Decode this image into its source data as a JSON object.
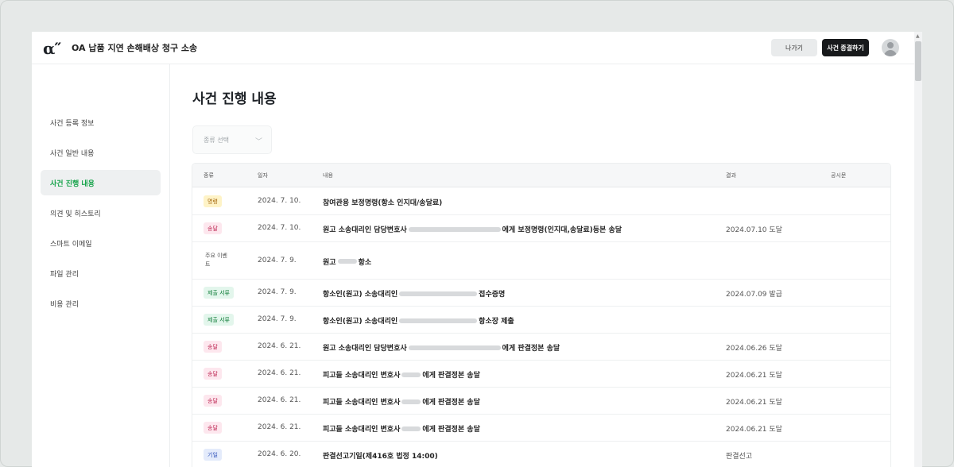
{
  "header": {
    "logo": "α″",
    "case_title": "OA 납품 지연 손해배상 청구 소송",
    "exit_label": "나가기",
    "close_case_label": "사건 종결하기",
    "avatar_icon": "user-avatar-icon"
  },
  "sidebar": {
    "items": [
      {
        "label": "사건 등록 정보",
        "active": false
      },
      {
        "label": "사건 일반 내용",
        "active": false
      },
      {
        "label": "사건 진행 내용",
        "active": true
      },
      {
        "label": "의견 및 히스토리",
        "active": false
      },
      {
        "label": "스마트 이메일",
        "active": false
      },
      {
        "label": "파일 관리",
        "active": false
      },
      {
        "label": "비용 관리",
        "active": false
      }
    ]
  },
  "main": {
    "title": "사건 진행 내용",
    "type_select_placeholder": "종류 선택",
    "table": {
      "columns": [
        "종류",
        "일자",
        "내용",
        "결과",
        "공시문"
      ],
      "rows": [
        {
          "type": "명령",
          "type_style": "t-order",
          "date": "2024. 7. 10.",
          "content_pre": "참여관용 보정명령(항소 인지대/송달료)",
          "redact_width": 0,
          "content_post": "",
          "result": ""
        },
        {
          "type": "송달",
          "type_style": "t-deliver",
          "date": "2024. 7. 10.",
          "content_pre": "원고 소송대리인 담당변호사",
          "redact_width": 116,
          "content_post": "에게 보정명령(인지대,송달료)등본 송달",
          "result": "2024.07.10 도달"
        },
        {
          "type": "주요 이벤트",
          "type_style": "t-event",
          "date": "2024. 7. 9.",
          "content_pre": "원고",
          "redact_width": 24,
          "content_post": " 항소",
          "result": ""
        },
        {
          "type": "제출 서류",
          "type_style": "t-submit",
          "date": "2024. 7. 9.",
          "content_pre": "항소인(원고) 소송대리인",
          "redact_width": 98,
          "content_post": " 접수증명",
          "result": "2024.07.09 발급"
        },
        {
          "type": "제출 서류",
          "type_style": "t-submit",
          "date": "2024. 7. 9.",
          "content_pre": "항소인(원고) 소송대리인",
          "redact_width": 98,
          "content_post": " 항소장 제출",
          "result": ""
        },
        {
          "type": "송달",
          "type_style": "t-deliver",
          "date": "2024. 6. 21.",
          "content_pre": "원고 소송대리인 담당변호사",
          "redact_width": 116,
          "content_post": "에게 판결정본 송달",
          "result": "2024.06.26 도달"
        },
        {
          "type": "송달",
          "type_style": "t-deliver",
          "date": "2024. 6. 21.",
          "content_pre": "피고들 소송대리인 변호사",
          "redact_width": 24,
          "content_post": "에게 판결정본 송달",
          "result": "2024.06.21 도달"
        },
        {
          "type": "송달",
          "type_style": "t-deliver",
          "date": "2024. 6. 21.",
          "content_pre": "피고들 소송대리인 변호사",
          "redact_width": 24,
          "content_post": "에게 판결정본 송달",
          "result": "2024.06.21 도달"
        },
        {
          "type": "송달",
          "type_style": "t-deliver",
          "date": "2024. 6. 21.",
          "content_pre": "피고들 소송대리인 변호사",
          "redact_width": 24,
          "content_post": "에게 판결정본 송달",
          "result": "2024.06.21 도달"
        },
        {
          "type": "기일",
          "type_style": "t-date",
          "date": "2024. 6. 20.",
          "content_pre": "판결선고기일(제416호 법정 14:00)",
          "redact_width": 0,
          "content_post": "",
          "result": "판결선고"
        }
      ]
    }
  }
}
